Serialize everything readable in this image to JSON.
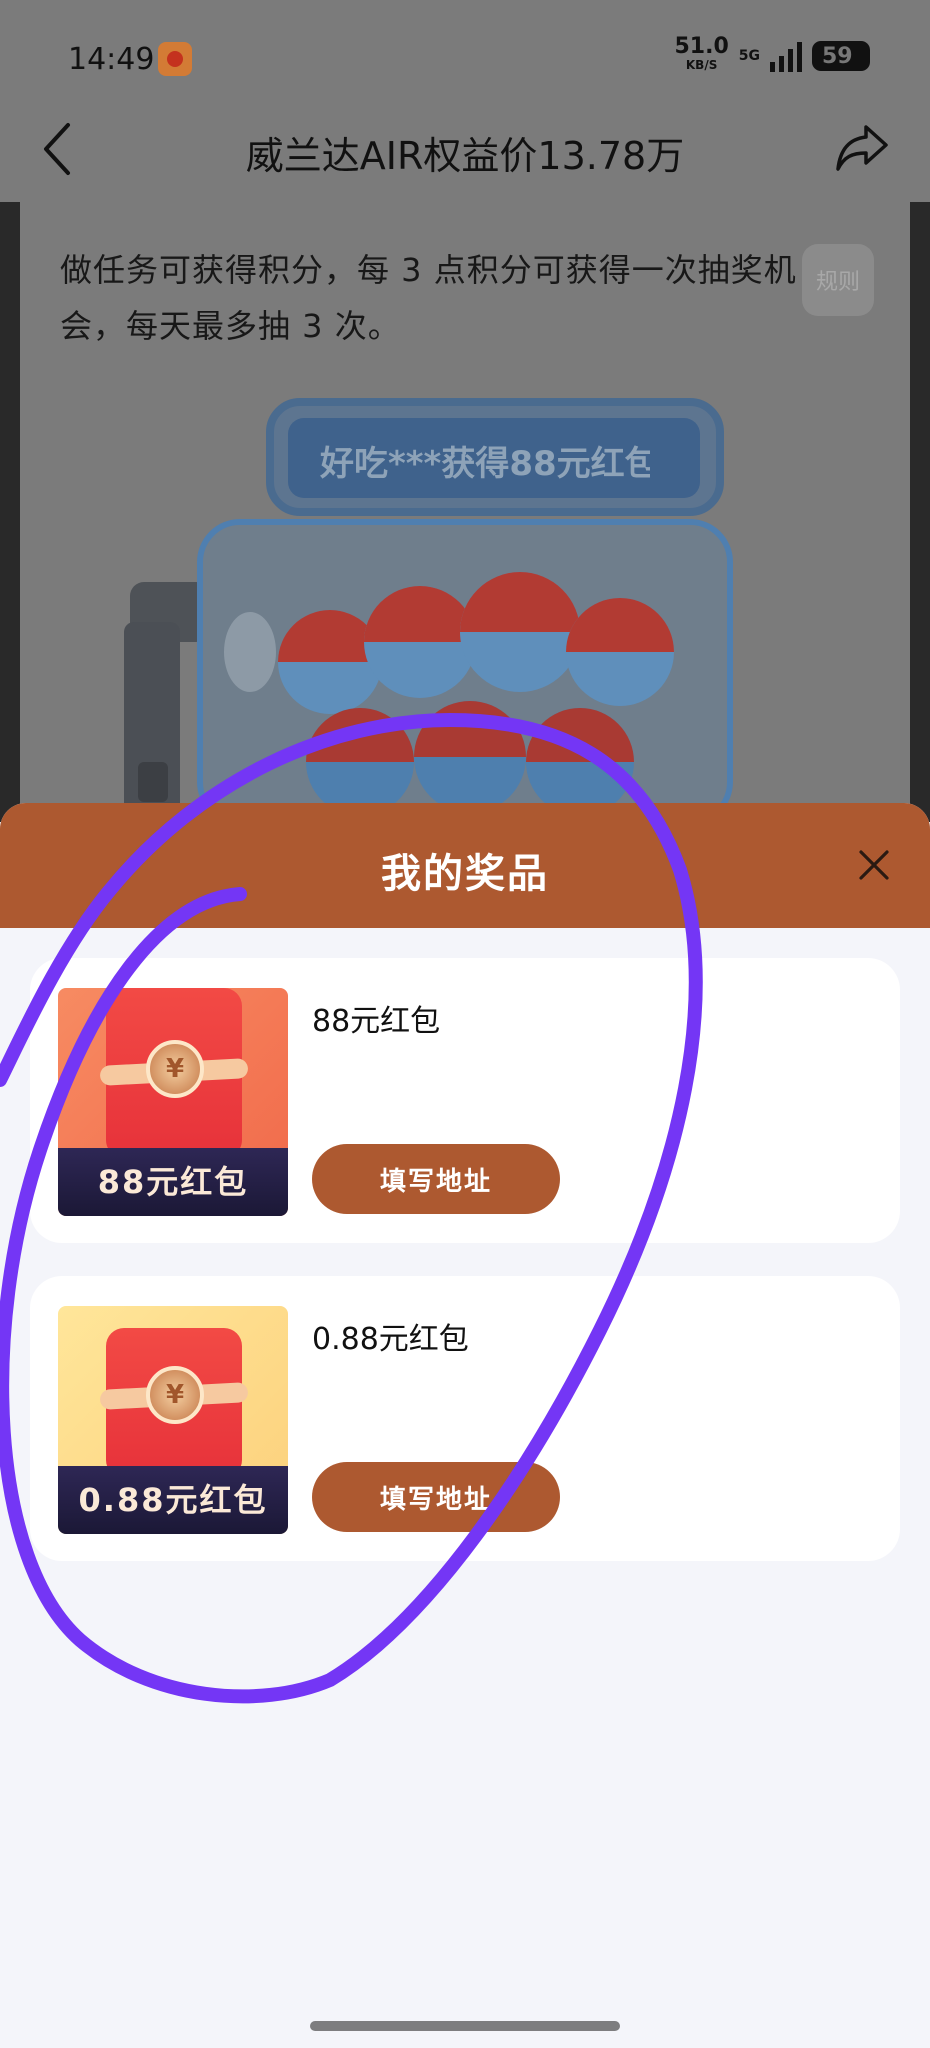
{
  "status_bar": {
    "time": "14:49",
    "net_speed": "51.0",
    "net_unit": "KB/S",
    "signal": "5G",
    "battery": "59"
  },
  "nav": {
    "title": "威兰达AIR权益价13.78万"
  },
  "page": {
    "intro": "做任务可获得积分，每 3 点积分可获得一次抽奖机会，每天最多抽 3 次。",
    "rules_label": "规则",
    "marquee": "好吃***获得88元红包"
  },
  "sheet": {
    "title": "我的奖品",
    "prizes": [
      {
        "name": "88元红包",
        "image_caption": "88元红包",
        "button_label": "填写地址"
      },
      {
        "name": "0.88元红包",
        "image_caption": "0.88元红包",
        "button_label": "填写地址"
      }
    ]
  },
  "colors": {
    "accent": "#ad5930",
    "annotation_stroke": "#7436f5",
    "overlay": "#7b7b7b"
  }
}
